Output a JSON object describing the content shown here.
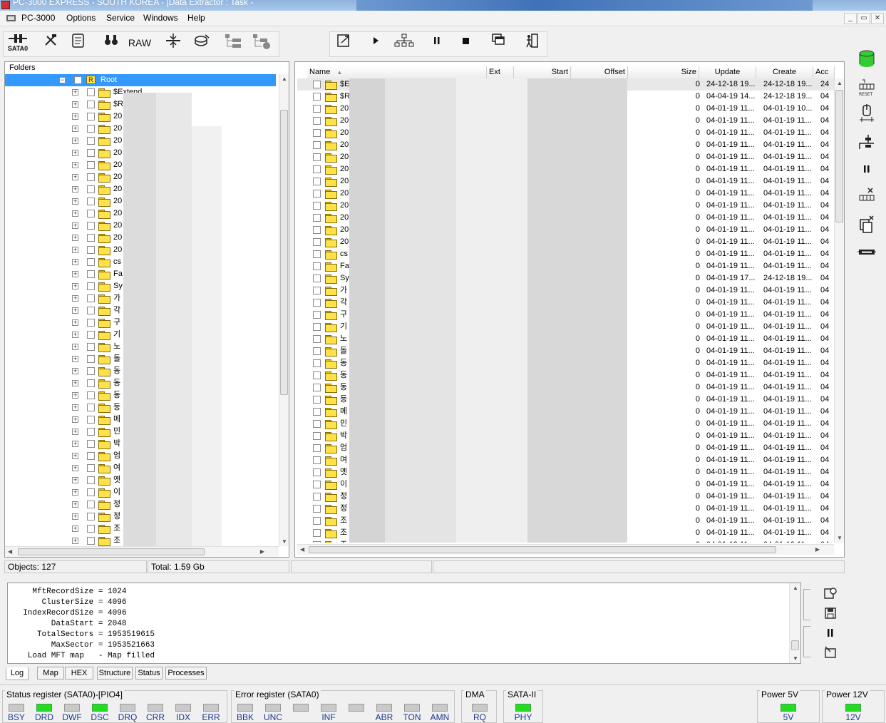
{
  "window": {
    "title": "PC-3000 EXPRESS - SOUTH KOREA - [Data Extractor : Task -",
    "app_menu_label": "PC-3000",
    "menu": [
      "Options",
      "Service",
      "Windows",
      "Help"
    ]
  },
  "toolbar": {
    "sata_label": "SATA0",
    "raw_label": "RAW"
  },
  "tree": {
    "header": "Folders",
    "root_label": "Root",
    "items": [
      "$Extend",
      "$R",
      "20",
      "20",
      "20",
      "20",
      "20",
      "20",
      "20",
      "20",
      "20",
      "20",
      "20",
      "20",
      "cs",
      "Fa",
      "Sy",
      "가",
      "각",
      "구",
      "기",
      "노",
      "돌",
      "동",
      "동",
      "동",
      "등",
      "메",
      "민",
      "박",
      "엄",
      "여",
      "옛",
      "이",
      "정",
      "정",
      "조",
      "조",
      "조"
    ]
  },
  "list": {
    "columns": [
      "Name",
      "Ext",
      "Start",
      "Offset",
      "Size",
      "Update",
      "Create",
      "Acc"
    ],
    "rows": [
      {
        "name": "$E",
        "size": "0",
        "update": "24-12-18 19...",
        "create": "24-12-18 19...",
        "acc": "24"
      },
      {
        "name": "$R",
        "size": "0",
        "update": "04-04-19 14...",
        "create": "24-12-18 19...",
        "acc": "04"
      },
      {
        "name": "20",
        "size": "0",
        "update": "04-01-19 11...",
        "create": "04-01-19 10...",
        "acc": "04"
      },
      {
        "name": "20",
        "size": "0",
        "update": "04-01-19 11...",
        "create": "04-01-19 11...",
        "acc": "04"
      },
      {
        "name": "20",
        "size": "0",
        "update": "04-01-19 11...",
        "create": "04-01-19 11...",
        "acc": "04"
      },
      {
        "name": "20",
        "size": "0",
        "update": "04-01-19 11...",
        "create": "04-01-19 11...",
        "acc": "04"
      },
      {
        "name": "20",
        "size": "0",
        "update": "04-01-19 11...",
        "create": "04-01-19 11...",
        "acc": "04"
      },
      {
        "name": "20",
        "size": "0",
        "update": "04-01-19 11...",
        "create": "04-01-19 11...",
        "acc": "04"
      },
      {
        "name": "20",
        "size": "0",
        "update": "04-01-19 11...",
        "create": "04-01-19 11...",
        "acc": "04"
      },
      {
        "name": "20",
        "size": "0",
        "update": "04-01-19 11...",
        "create": "04-01-19 11...",
        "acc": "04"
      },
      {
        "name": "20",
        "size": "0",
        "update": "04-01-19 11...",
        "create": "04-01-19 11...",
        "acc": "04"
      },
      {
        "name": "20",
        "size": "0",
        "update": "04-01-19 11...",
        "create": "04-01-19 11...",
        "acc": "04"
      },
      {
        "name": "20",
        "size": "0",
        "update": "04-01-19 11...",
        "create": "04-01-19 11...",
        "acc": "04"
      },
      {
        "name": "20",
        "size": "0",
        "update": "04-01-19 11...",
        "create": "04-01-19 11...",
        "acc": "04"
      },
      {
        "name": "cs",
        "size": "0",
        "update": "04-01-19 11...",
        "create": "04-01-19 11...",
        "acc": "04"
      },
      {
        "name": "Fa",
        "size": "0",
        "update": "04-01-19 11...",
        "create": "04-01-19 11...",
        "acc": "04"
      },
      {
        "name": "Sy",
        "size": "0",
        "update": "04-01-19 17...",
        "create": "24-12-18 19...",
        "acc": "04"
      },
      {
        "name": "가",
        "size": "0",
        "update": "04-01-19 11...",
        "create": "04-01-19 11...",
        "acc": "04"
      },
      {
        "name": "각",
        "size": "0",
        "update": "04-01-19 11...",
        "create": "04-01-19 11...",
        "acc": "04"
      },
      {
        "name": "구",
        "size": "0",
        "update": "04-01-19 11...",
        "create": "04-01-19 11...",
        "acc": "04"
      },
      {
        "name": "기",
        "size": "0",
        "update": "04-01-19 11...",
        "create": "04-01-19 11...",
        "acc": "04"
      },
      {
        "name": "노",
        "size": "0",
        "update": "04-01-19 11...",
        "create": "04-01-19 11...",
        "acc": "04"
      },
      {
        "name": "돌",
        "size": "0",
        "update": "04-01-19 11...",
        "create": "04-01-19 11...",
        "acc": "04"
      },
      {
        "name": "동",
        "size": "0",
        "update": "04-01-19 11...",
        "create": "04-01-19 11...",
        "acc": "04"
      },
      {
        "name": "동",
        "size": "0",
        "update": "04-01-19 11...",
        "create": "04-01-19 11...",
        "acc": "04"
      },
      {
        "name": "동",
        "size": "0",
        "update": "04-01-19 11...",
        "create": "04-01-19 11...",
        "acc": "04"
      },
      {
        "name": "등",
        "size": "0",
        "update": "04-01-19 11...",
        "create": "04-01-19 11...",
        "acc": "04"
      },
      {
        "name": "메",
        "size": "0",
        "update": "04-01-19 11...",
        "create": "04-01-19 11...",
        "acc": "04"
      },
      {
        "name": "민",
        "size": "0",
        "update": "04-01-19 11...",
        "create": "04-01-19 11...",
        "acc": "04"
      },
      {
        "name": "박",
        "size": "0",
        "update": "04-01-19 11...",
        "create": "04-01-19 11...",
        "acc": "04"
      },
      {
        "name": "엄",
        "size": "0",
        "update": "04-01-19 11...",
        "create": "04-01-19 11...",
        "acc": "04"
      },
      {
        "name": "여",
        "size": "0",
        "update": "04-01-19 11...",
        "create": "04-01-19 11...",
        "acc": "04"
      },
      {
        "name": "옛",
        "size": "0",
        "update": "04-01-19 11...",
        "create": "04-01-19 11...",
        "acc": "04"
      },
      {
        "name": "이",
        "size": "0",
        "update": "04-01-19 11...",
        "create": "04-01-19 11...",
        "acc": "04"
      },
      {
        "name": "정",
        "size": "0",
        "update": "04-01-19 11...",
        "create": "04-01-19 11...",
        "acc": "04"
      },
      {
        "name": "정",
        "size": "0",
        "update": "04-01-19 11...",
        "create": "04-01-19 11...",
        "acc": "04"
      },
      {
        "name": "조",
        "size": "0",
        "update": "04-01-19 11...",
        "create": "04-01-19 11...",
        "acc": "04"
      },
      {
        "name": "조",
        "size": "0",
        "update": "04-01-19 11...",
        "create": "04-01-19 11...",
        "acc": "04"
      },
      {
        "name": "조",
        "size": "0",
        "update": "04-01-19 11...",
        "create": "04-01-19 11...",
        "acc": "04"
      }
    ]
  },
  "status": {
    "objects": "Objects: 127",
    "total": "Total: 1.59 Gb"
  },
  "log": {
    "lines": [
      "    MftRecordSize = 1024",
      "      ClusterSize = 4096",
      "  IndexRecordSize = 4096",
      "        DataStart = 2048",
      "     TotalSectors = 1953519615",
      "        MaxSector = 1953521663",
      "   Load MFT map   - Map filled"
    ]
  },
  "tabs": [
    "Log",
    "Map",
    "HEX",
    "Structure",
    "Status",
    "Processes"
  ],
  "registers": {
    "status_title": "Status register (SATA0)-[PIO4]",
    "status_leds": [
      {
        "label": "BSY",
        "on": false
      },
      {
        "label": "DRD",
        "on": true
      },
      {
        "label": "DWF",
        "on": false
      },
      {
        "label": "DSC",
        "on": true
      },
      {
        "label": "DRQ",
        "on": false
      },
      {
        "label": "CRR",
        "on": false
      },
      {
        "label": "IDX",
        "on": false
      },
      {
        "label": "ERR",
        "on": false
      }
    ],
    "error_title": "Error register (SATA0)",
    "error_leds": [
      {
        "label": "BBK",
        "on": false
      },
      {
        "label": "UNC",
        "on": false
      },
      {
        "label": "",
        "on": false
      },
      {
        "label": "INF",
        "on": false
      },
      {
        "label": "",
        "on": false
      },
      {
        "label": "ABR",
        "on": false
      },
      {
        "label": "TON",
        "on": false
      },
      {
        "label": "AMN",
        "on": false
      }
    ],
    "dma_title": "DMA",
    "dma_led": "RQ",
    "sata_title": "SATA-II",
    "sata_led": "PHY",
    "p5_title": "Power 5V",
    "p5_led": "5V",
    "p12_title": "Power 12V",
    "p12_led": "12V"
  },
  "colors": {
    "selection": "#3399ff",
    "led_on": "#22dd22",
    "led_off": "#c9c9c9"
  }
}
